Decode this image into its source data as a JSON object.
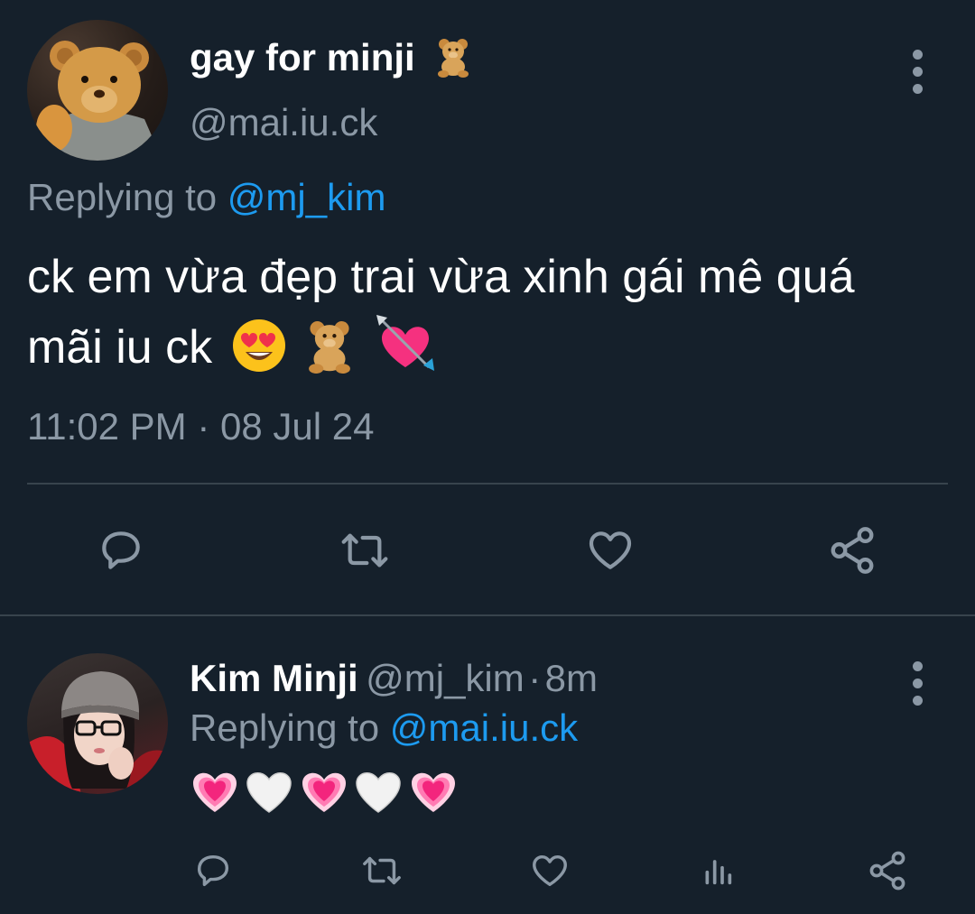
{
  "main_tweet": {
    "author": {
      "display_name": "gay for minji",
      "name_emoji": "teddy-bear",
      "handle": "@mai.iu.ck"
    },
    "replying_prefix": "Replying to",
    "replying_to": "@mj_kim",
    "text_line1": "ck em vừa đẹp trai vừa xinh gái mê quá",
    "text_line2": "mãi iu ck",
    "text_emojis": [
      "smiling-face-with-heart-eyes",
      "teddy-bear",
      "heart-with-arrow"
    ],
    "timestamp": "11:02 PM · 08 Jul 24",
    "actions": [
      "reply-icon",
      "retweet-icon",
      "like-icon",
      "share-icon"
    ]
  },
  "reply_tweet": {
    "author": {
      "display_name": "Kim Minji",
      "handle": "@mj_kim",
      "separator": "·",
      "time_ago": "8m"
    },
    "replying_prefix": "Replying to",
    "replying_to": "@mai.iu.ck",
    "text_emojis": [
      "growing-heart",
      "white-heart",
      "growing-heart",
      "white-heart",
      "growing-heart"
    ],
    "actions": [
      "reply-icon",
      "retweet-icon",
      "like-icon",
      "analytics-icon",
      "share-icon"
    ]
  },
  "colors": {
    "background": "#15202b",
    "text_primary": "#ffffff",
    "text_secondary": "#8b98a5",
    "link": "#1d9bf0",
    "divider": "#38444d"
  }
}
